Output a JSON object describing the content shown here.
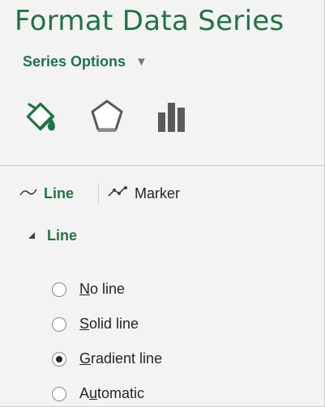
{
  "pane": {
    "title": "Format Data Series"
  },
  "series_options": {
    "label": "Series Options",
    "caret": "▼"
  },
  "icon_tabs": [
    {
      "name": "fill-line",
      "icon": "paint-bucket-icon",
      "selected": true
    },
    {
      "name": "effects",
      "icon": "pentagon-icon",
      "selected": false
    },
    {
      "name": "series-options",
      "icon": "bar-chart-icon",
      "selected": false
    }
  ],
  "subtabs": {
    "line": {
      "label": "Line",
      "icon": "line-icon",
      "active": true
    },
    "marker": {
      "label": "Marker",
      "icon": "marker-icon",
      "active": false
    }
  },
  "section": {
    "label": "Line",
    "expanded": true
  },
  "line_options": [
    {
      "access_key": "N",
      "rest": "o line",
      "checked": false
    },
    {
      "access_key": "S",
      "rest": "olid line",
      "checked": false
    },
    {
      "access_key": "G",
      "rest": "radient line",
      "checked": true
    },
    {
      "prefix": "A",
      "access_key": "u",
      "rest": "tomatic",
      "checked": false
    }
  ],
  "colors": {
    "accent": "#217346",
    "background": "#f3f3f3",
    "text": "#262626"
  }
}
